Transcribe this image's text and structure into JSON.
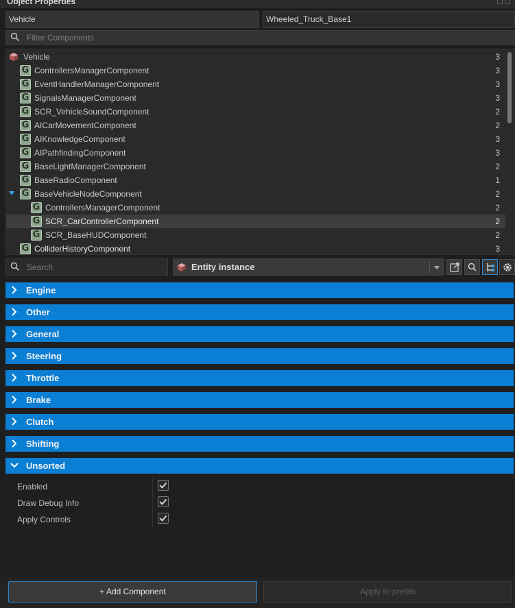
{
  "window": {
    "title": "Object Properties"
  },
  "header": {
    "type_field": "Vehicle",
    "name_field": "Wheeled_Truck_Base1"
  },
  "filter": {
    "placeholder": "Filter Components"
  },
  "tree": {
    "items": [
      {
        "label": "Vehicle",
        "count": "3",
        "icon": "entity-cube-icon"
      },
      {
        "label": "ControllersManagerComponent",
        "count": "3",
        "icon": "component-g-icon"
      },
      {
        "label": "EventHandlerManagerComponent",
        "count": "3",
        "icon": "component-g-icon"
      },
      {
        "label": "SignalsManagerComponent",
        "count": "3",
        "icon": "component-g-icon"
      },
      {
        "label": "SCR_VehicleSoundComponent",
        "count": "2",
        "icon": "component-g-icon"
      },
      {
        "label": "AICarMovementComponent",
        "count": "2",
        "icon": "component-g-icon"
      },
      {
        "label": "AIKnowledgeComponent",
        "count": "3",
        "icon": "component-g-icon"
      },
      {
        "label": "AIPathfindingComponent",
        "count": "3",
        "icon": "component-g-icon"
      },
      {
        "label": "BaseLightManagerComponent",
        "count": "2",
        "icon": "component-g-icon"
      },
      {
        "label": "BaseRadioComponent",
        "count": "1",
        "icon": "component-g-icon"
      },
      {
        "label": "BaseVehicleNodeComponent",
        "count": "2",
        "icon": "component-g-icon"
      },
      {
        "label": "ControllersManagerComponent",
        "count": "2",
        "icon": "component-g-icon"
      },
      {
        "label": "SCR_CarControllerComponent",
        "count": "2",
        "icon": "component-g-icon"
      },
      {
        "label": "SCR_BaseHUDComponent",
        "count": "2",
        "icon": "component-g-icon"
      },
      {
        "label": "ColliderHistoryComponent",
        "count": "3",
        "icon": "component-g-icon"
      }
    ]
  },
  "toolbar": {
    "search_placeholder": "Search",
    "entity_select_value": "Entity instance"
  },
  "categories": [
    {
      "label": "Engine",
      "expanded": false
    },
    {
      "label": "Other",
      "expanded": false
    },
    {
      "label": "General",
      "expanded": false
    },
    {
      "label": "Steering",
      "expanded": false
    },
    {
      "label": "Throttle",
      "expanded": false
    },
    {
      "label": "Brake",
      "expanded": false
    },
    {
      "label": "Clutch",
      "expanded": false
    },
    {
      "label": "Shifting",
      "expanded": false
    },
    {
      "label": "Unsorted",
      "expanded": true
    }
  ],
  "properties": [
    {
      "label": "Enabled",
      "checked": true
    },
    {
      "label": "Draw Debug Info",
      "checked": true
    },
    {
      "label": "Apply Controls",
      "checked": true
    }
  ],
  "buttons": {
    "add_component": "+ Add Component",
    "apply_to_prefab": "Apply to prefab"
  },
  "colors": {
    "accent": "#0b7fd4",
    "background": "#1e1e1e",
    "panel": "#2a2a2a"
  }
}
